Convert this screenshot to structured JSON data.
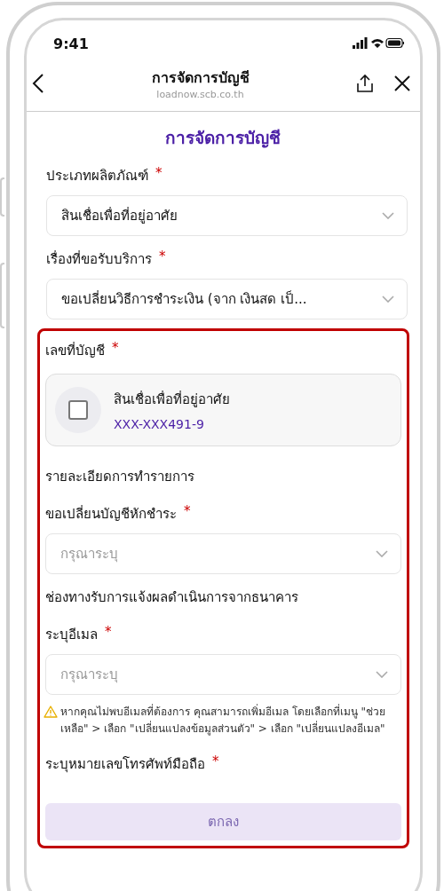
{
  "status_bar": {
    "time": "9:41"
  },
  "header": {
    "title": "การจัดการบัญชี",
    "url": "loadnow.scb.co.th"
  },
  "page_title": "การจัดการบัญชี",
  "form": [
    {
      "kind": "select",
      "label": "ประเภทผลิตภัณฑ์",
      "required_mark": "*",
      "value": "สินเชื่อเพื่อที่อยู่อาศัย"
    },
    {
      "kind": "select",
      "label": "เรื่องที่ขอรับบริการ",
      "required_mark": "*",
      "value": "ขอเปลี่ยนวิธีการชำระเงิน (จาก เงินสด เป็..."
    }
  ],
  "highlighted_section": {
    "items": [
      {
        "kind": "account",
        "label": "เลขที่บัญชี",
        "required_mark": "*",
        "name": "สินเชื่อเพื่อที่อยู่อาศัย",
        "number": "XXX-XXX491-9",
        "checked": false
      },
      {
        "kind": "heading",
        "text": "รายละเอียดการทำรายการ"
      },
      {
        "kind": "select",
        "label": "ขอเปลี่ยนบัญชีหักชำระ",
        "required_mark": "*",
        "placeholder": "กรุณาระบุ"
      },
      {
        "kind": "heading",
        "text": "ช่องทางรับการแจ้งผลดำเนินการจากธนาคาร"
      },
      {
        "kind": "select",
        "label": "ระบุอีเมล",
        "required_mark": "*",
        "placeholder": "กรุณาระบุ"
      },
      {
        "kind": "note",
        "text": "หากคุณไม่พบอีเมลที่ต้องการ คุณสามารถเพิ่มอีเมล โดยเลือกที่เมนู \"ช่วยเหลือ\" > เลือก \"เปลี่ยนแปลงข้อมูลส่วนตัว\" > เลือก \"เปลี่ยนแปลงอีเมล\""
      },
      {
        "kind": "label",
        "label": "ระบุหมายเลขโทรศัพท์มือถือ",
        "required_mark": "*"
      }
    ],
    "submit": {
      "label": "ตกลง",
      "disabled": true
    }
  }
}
